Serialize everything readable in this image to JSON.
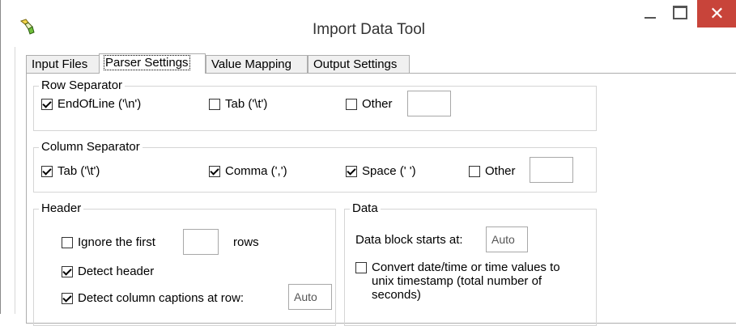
{
  "window": {
    "title": "Import Data Tool",
    "close_glyph": "✕"
  },
  "tabs": [
    {
      "label": "Input Files",
      "active": false
    },
    {
      "label": "Parser Settings",
      "active": true
    },
    {
      "label": "Value Mapping",
      "active": false
    },
    {
      "label": "Output Settings",
      "active": false
    }
  ],
  "row_separator": {
    "title": "Row Separator",
    "endofline": {
      "label": "EndOfLine ('\\n')",
      "checked": true
    },
    "tab": {
      "label": "Tab ('\\t')",
      "checked": false
    },
    "other": {
      "label": "Other",
      "checked": false,
      "value": ""
    }
  },
  "column_separator": {
    "title": "Column Separator",
    "tab": {
      "label": "Tab ('\\t')",
      "checked": true
    },
    "comma": {
      "label": "Comma (',')",
      "checked": true
    },
    "space": {
      "label": "Space (' ')",
      "checked": true
    },
    "other": {
      "label": "Other",
      "checked": false,
      "value": ""
    }
  },
  "header": {
    "title": "Header",
    "ignore_first": {
      "label": "Ignore the first",
      "checked": false,
      "value": "",
      "suffix": "rows"
    },
    "detect_header": {
      "label": "Detect header",
      "checked": true
    },
    "detect_captions": {
      "label": "Detect column captions at row:",
      "checked": true,
      "value": "Auto"
    }
  },
  "data": {
    "title": "Data",
    "block_start_label": "Data block starts at:",
    "block_start_value": "Auto",
    "convert": {
      "label": "Convert date/time or time values to unix timestamp (total number of seconds)",
      "checked": false
    }
  },
  "colors": {
    "close_button": "#c8443a",
    "group_border": "#d5d5d5"
  }
}
